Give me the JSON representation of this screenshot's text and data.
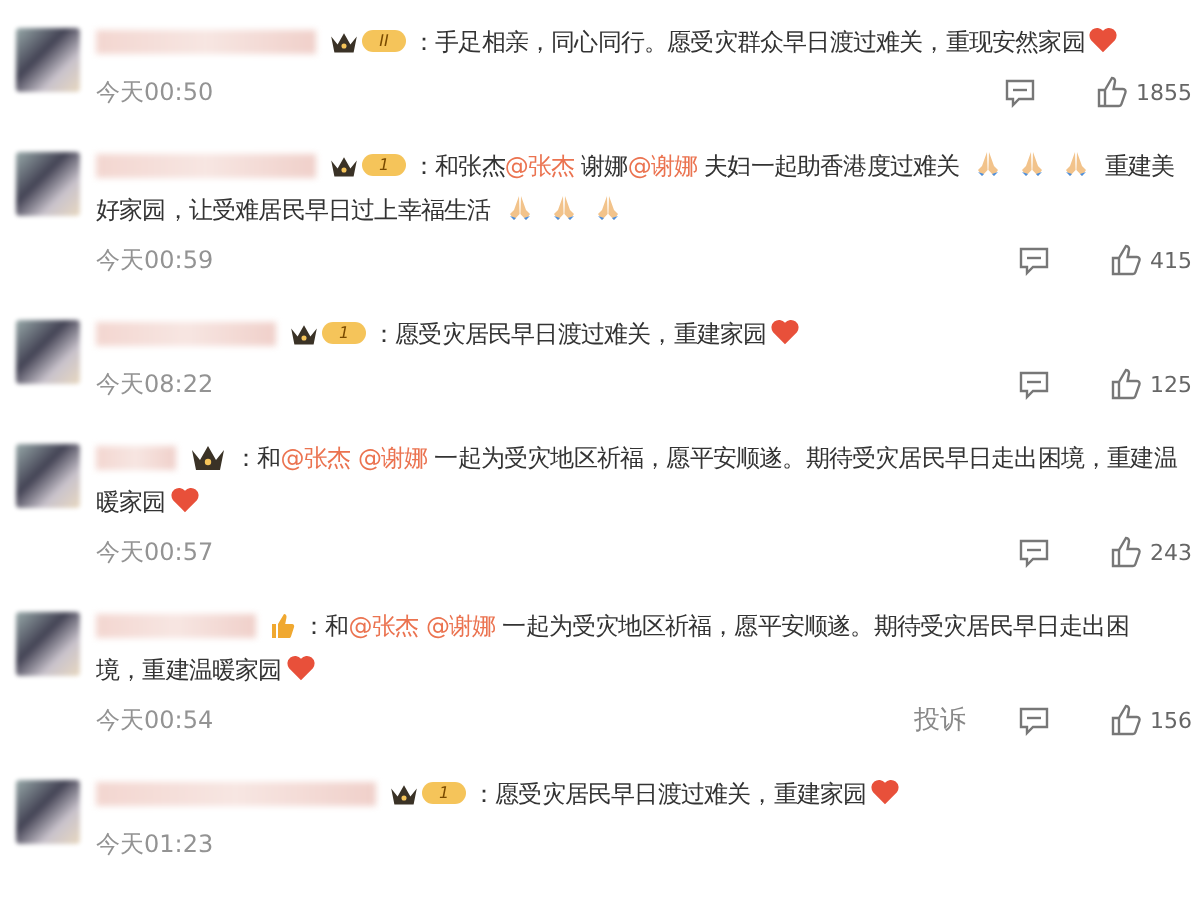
{
  "comments": [
    {
      "badge": {
        "kind": "crown",
        "text": "II"
      },
      "lines": [
        [
          {
            "kind": "text",
            "text": "：手足相亲，同心同行。愿受灾群众早日渡过难关，重现安然家园"
          },
          {
            "kind": "heart"
          }
        ]
      ],
      "time": "今天00:50",
      "likes": "1855"
    },
    {
      "badge": {
        "kind": "crown",
        "text": "1"
      },
      "lines": [
        [
          {
            "kind": "text",
            "text": "：和张杰"
          },
          {
            "kind": "mention",
            "text": "@张杰"
          },
          {
            "kind": "text",
            "text": " 谢娜"
          },
          {
            "kind": "mention",
            "text": "@谢娜"
          },
          {
            "kind": "text",
            "text": " 夫妇一起助香港度过难关 "
          },
          {
            "kind": "pray"
          },
          {
            "kind": "pray"
          },
          {
            "kind": "pray"
          },
          {
            "kind": "text",
            "text": " 重建美"
          }
        ],
        [
          {
            "kind": "text",
            "text": "好家园，让受难居民早日过上幸福生活 "
          },
          {
            "kind": "pray"
          },
          {
            "kind": "pray"
          },
          {
            "kind": "pray"
          }
        ]
      ],
      "time": "今天00:59",
      "likes": "415"
    },
    {
      "badge": {
        "kind": "crown",
        "text": "1"
      },
      "lines": [
        [
          {
            "kind": "text",
            "text": "：愿受灾居民早日渡过难关，重建家园"
          },
          {
            "kind": "heart"
          }
        ]
      ],
      "time": "今天08:22",
      "likes": "125"
    },
    {
      "badge": {
        "kind": "crown-small"
      },
      "lines": [
        [
          {
            "kind": "text",
            "text": "：和"
          },
          {
            "kind": "mention",
            "text": "@张杰"
          },
          {
            "kind": "mention",
            "text": "@谢娜"
          },
          {
            "kind": "text",
            "text": " 一起为受灾地区祈福，愿平安顺遂。期待受灾居民早日走出困境，重建温"
          }
        ],
        [
          {
            "kind": "text",
            "text": "暖家园"
          },
          {
            "kind": "heart"
          }
        ]
      ],
      "time": "今天00:57",
      "likes": "243"
    },
    {
      "badge": {
        "kind": "thumb"
      },
      "lines": [
        [
          {
            "kind": "text",
            "text": "：和"
          },
          {
            "kind": "mention",
            "text": "@张杰"
          },
          {
            "kind": "mention",
            "text": "@谢娜"
          },
          {
            "kind": "text",
            "text": " 一起为受灾地区祈福，愿平安顺遂。期待受灾居民早日走出困"
          }
        ],
        [
          {
            "kind": "text",
            "text": "境，重建温暖家园"
          },
          {
            "kind": "heart"
          }
        ]
      ],
      "time": "今天00:54",
      "report": "投诉",
      "likes": "156"
    },
    {
      "badge": {
        "kind": "crown",
        "text": "1"
      },
      "lines": [
        [
          {
            "kind": "text",
            "text": "：愿受灾居民早日渡过难关，重建家园"
          },
          {
            "kind": "heart"
          }
        ]
      ],
      "time": "今天01:23"
    }
  ]
}
